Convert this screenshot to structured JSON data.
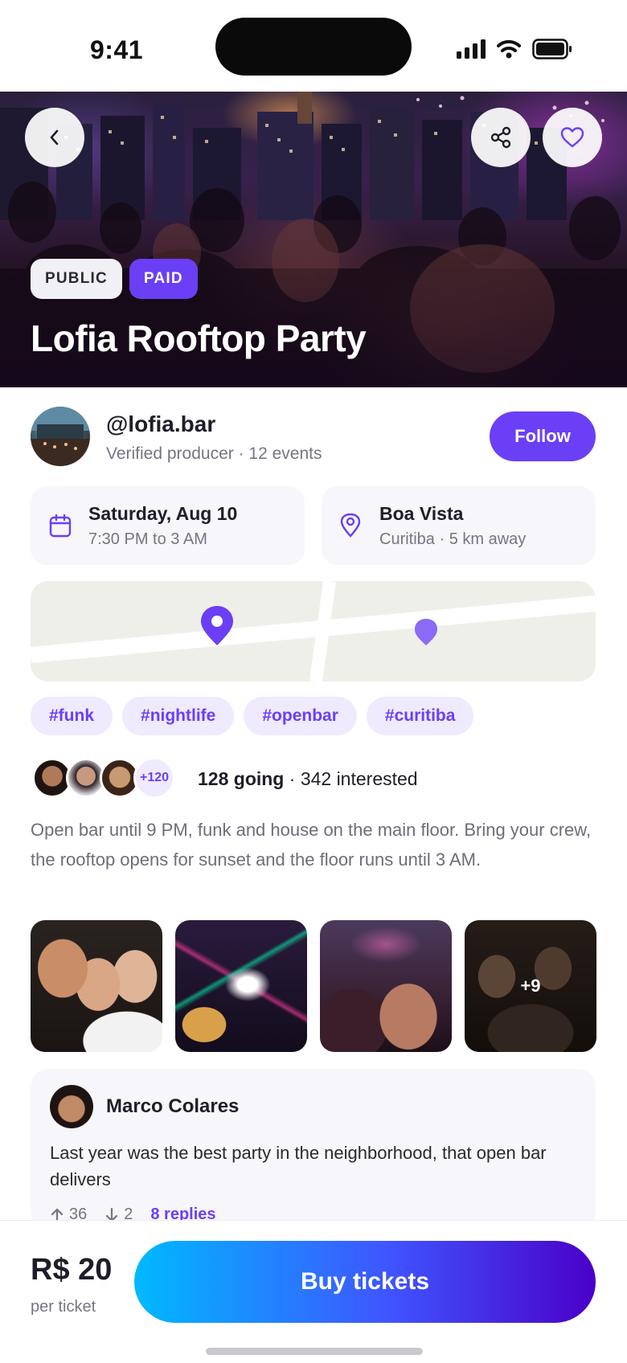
{
  "status_bar": {
    "time": "9:41"
  },
  "hero": {
    "badges": [
      "PUBLIC",
      "PAID"
    ],
    "title": "Lofia Rooftop Party"
  },
  "producer": {
    "handle": "@lofia.bar",
    "meta": "Verified producer · 12 events",
    "follow_label": "Follow"
  },
  "event": {
    "date": "Saturday, Aug 10",
    "time": "7:30 PM to 3 AM",
    "venue": "Boa Vista",
    "location": "Curitiba · 5 km away"
  },
  "tags": [
    "#funk",
    "#nightlife",
    "#openbar",
    "#curitiba"
  ],
  "attendance": {
    "more_count": "+120",
    "going": "128 going",
    "interested": "342 interested"
  },
  "description": "Open bar until 9 PM, funk and house on the main floor. Bring your crew, the rooftop opens for sunset and the floor runs until 3 AM.",
  "gallery": {
    "more_label": "+9"
  },
  "comment": {
    "author": "Marco Colares",
    "text": "Last year was the best party in the neighborhood, that open bar delivers",
    "upvotes": "36",
    "downvotes": "2",
    "replies": "8 replies"
  },
  "checkout": {
    "price": "R$ 20",
    "price_unit": "per ticket",
    "buy_label": "Buy tickets"
  },
  "colors": {
    "accent": "#6b3ff5",
    "accent_soft": "#efeafd",
    "button_gradient_start": "#00b9ff",
    "button_gradient_end": "#4b00c8"
  },
  "icons": {
    "back": "chevron-left-icon",
    "share": "share-icon",
    "favorite": "heart-icon",
    "date": "calendar-icon",
    "location": "map-pin-icon",
    "upvote": "arrow-up-icon",
    "downvote": "arrow-down-icon"
  }
}
